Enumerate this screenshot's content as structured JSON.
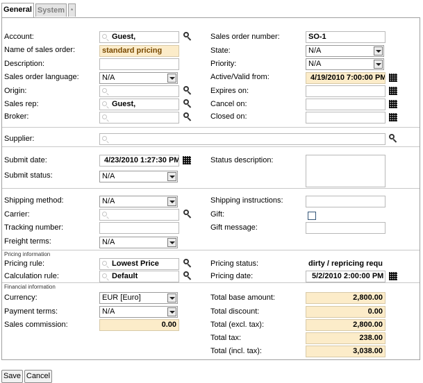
{
  "tabs": [
    {
      "label": "General"
    },
    {
      "label": "System"
    },
    {
      "label": "*"
    }
  ],
  "sections": {
    "pricing": "Pricing information",
    "financial": "Financial information"
  },
  "fields": {
    "account": {
      "label": "Account:",
      "value": "Guest,"
    },
    "sales_order_name": {
      "label": "Name of sales order:",
      "value": "standard pricing"
    },
    "description": {
      "label": "Description:",
      "value": ""
    },
    "sales_order_language": {
      "label": "Sales order language:",
      "value": "N/A"
    },
    "origin": {
      "label": "Origin:",
      "value": ""
    },
    "sales_rep": {
      "label": "Sales rep:",
      "value": "Guest,"
    },
    "broker": {
      "label": "Broker:",
      "value": ""
    },
    "sales_order_number": {
      "label": "Sales order number:",
      "value": "SO-1"
    },
    "state": {
      "label": "State:",
      "value": "N/A"
    },
    "priority": {
      "label": "Priority:",
      "value": "N/A"
    },
    "active_valid_from": {
      "label": "Active/Valid from:",
      "value": "4/19/2010 7:00:00 PM"
    },
    "expires_on": {
      "label": "Expires on:",
      "value": ""
    },
    "cancel_on": {
      "label": "Cancel on:",
      "value": ""
    },
    "closed_on": {
      "label": "Closed on:",
      "value": ""
    },
    "supplier": {
      "label": "Supplier:",
      "value": ""
    },
    "submit_date": {
      "label": "Submit date:",
      "value": "4/23/2010 1:27:30 PM"
    },
    "submit_status": {
      "label": "Submit status:",
      "value": "N/A"
    },
    "status_description": {
      "label": "Status description:",
      "value": ""
    },
    "shipping_method": {
      "label": "Shipping method:",
      "value": "N/A"
    },
    "carrier": {
      "label": "Carrier:",
      "value": ""
    },
    "tracking_number": {
      "label": "Tracking number:",
      "value": ""
    },
    "freight_terms": {
      "label": "Freight terms:",
      "value": "N/A"
    },
    "shipping_instructions": {
      "label": "Shipping instructions:",
      "value": ""
    },
    "gift": {
      "label": "Gift:",
      "value": ""
    },
    "gift_message": {
      "label": "Gift message:",
      "value": ""
    },
    "pricing_rule": {
      "label": "Pricing rule:",
      "value": "Lowest Price"
    },
    "calculation_rule": {
      "label": "Calculation rule:",
      "value": "Default"
    },
    "pricing_status": {
      "label": "Pricing status:",
      "value": "dirty / repricing requ"
    },
    "pricing_date": {
      "label": "Pricing date:",
      "value": "5/2/2010 2:00:00 PM"
    },
    "currency": {
      "label": "Currency:",
      "value": "EUR [Euro]"
    },
    "payment_terms": {
      "label": "Payment terms:",
      "value": "N/A"
    },
    "sales_commission": {
      "label": "Sales commission:",
      "value": "0.00"
    },
    "total_base_amount": {
      "label": "Total base amount:",
      "value": "2,800.00"
    },
    "total_discount": {
      "label": "Total discount:",
      "value": "0.00"
    },
    "total_excl_tax": {
      "label": "Total (excl. tax):",
      "value": "2,800.00"
    },
    "total_tax": {
      "label": "Total tax:",
      "value": "238.00"
    },
    "total_incl_tax": {
      "label": "Total (incl. tax):",
      "value": "3,038.00"
    }
  },
  "buttons": {
    "save": "Save",
    "cancel": "Cancel"
  },
  "colors": {
    "readonly_bg": "#fcecc9",
    "border": "#a0a0a0"
  }
}
